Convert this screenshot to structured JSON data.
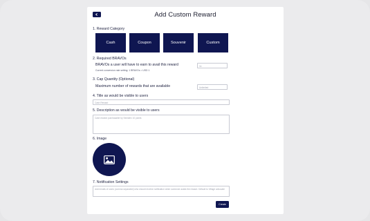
{
  "header": {
    "title": "Add Custom Reward",
    "back_icon": "chevron-left-icon"
  },
  "section1": {
    "label": "1. Reward Category",
    "categories": [
      "Cash",
      "Coupon",
      "Souvenir",
      "Custom"
    ]
  },
  "section2": {
    "label": "2. Required BRAVOs",
    "text": "BRAVOs a user will have to earn to avail this reward",
    "hint": "Current conversion rate setting: 1 BRAVOs = USD 1",
    "input_placeholder": "1k"
  },
  "section3": {
    "label": "3. Cap Quantity (Optional)",
    "text": "Maximum number of rewards that are available",
    "input_placeholder": "Unlimited"
  },
  "section4": {
    "label": "4. Title as would be visible to users",
    "input_placeholder": "Cash Reward"
  },
  "section5": {
    "label": "5. Description as would be visible to users",
    "input_placeholder": "Cash reward purchasable by Sensitrix 10 points"
  },
  "section6": {
    "label": "6. Image",
    "icon": "image-icon"
  },
  "section7": {
    "label": "7. Notification Settings",
    "input_placeholder": "Add emails of users (comma separated) who should receive notification when someone avails the reward. Default to Village advocate"
  },
  "footer": {
    "create_label": "Create"
  },
  "colors": {
    "primary": "#0f1651",
    "background": "#ebebed",
    "card": "#ffffff"
  }
}
